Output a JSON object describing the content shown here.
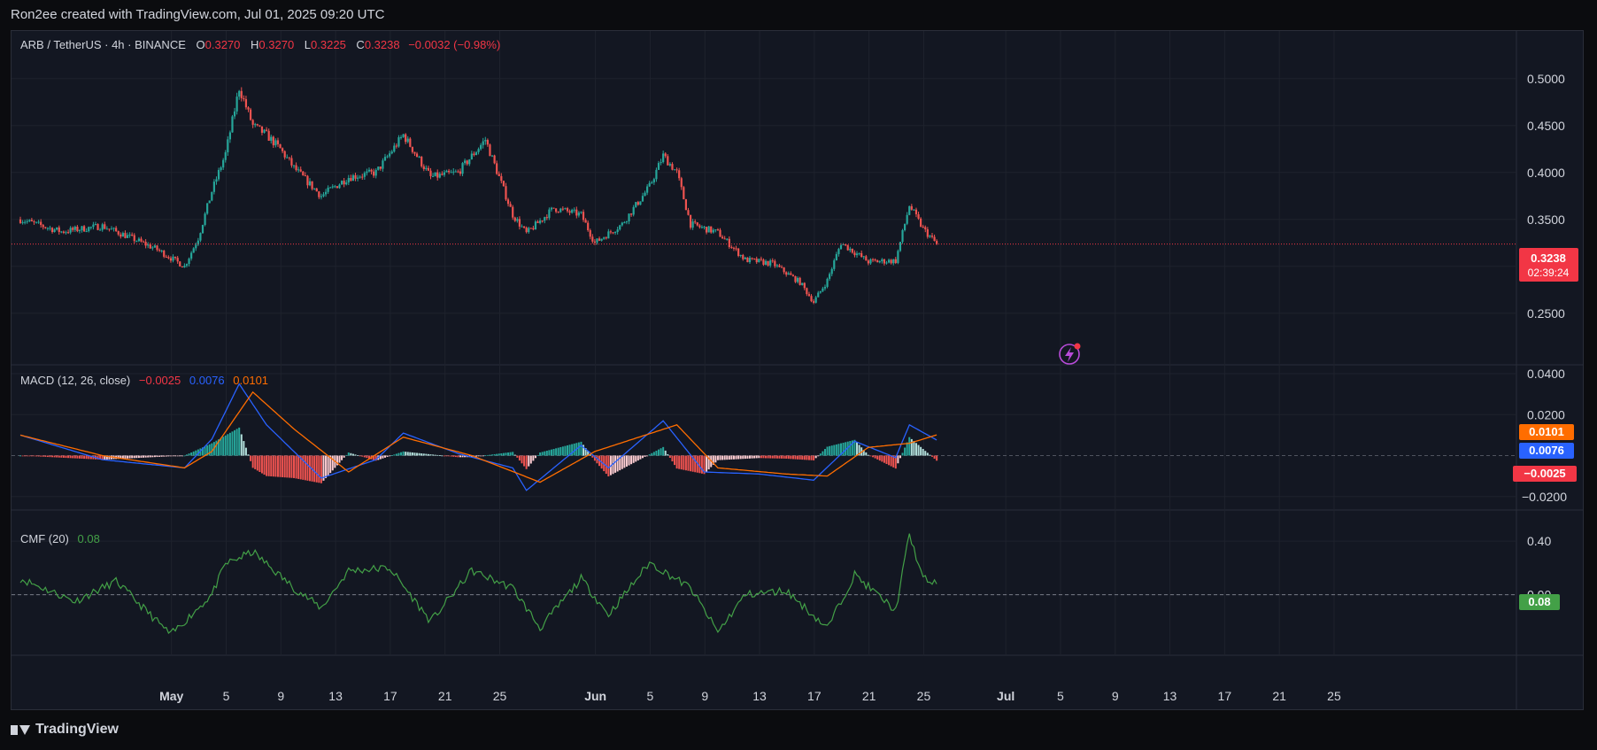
{
  "header": {
    "credit": "Ron2ee created with TradingView.com, Jul 01, 2025 09:20 UTC"
  },
  "legend": {
    "symbol": "ARB / TetherUS · 4h · BINANCE",
    "o_label": "O",
    "o_value": "0.3270",
    "h_label": "H",
    "h_value": "0.3270",
    "l_label": "L",
    "l_value": "0.3225",
    "c_label": "C",
    "c_value": "0.3238",
    "change": "−0.0032 (−0.98%)"
  },
  "price_badge": {
    "price": "0.3238",
    "countdown": "02:39:24"
  },
  "macd_legend": {
    "name": "MACD (12, 26, close)",
    "hist": "−0.0025",
    "macd": "0.0076",
    "signal": "0.0101"
  },
  "macd_badges": {
    "signal": "0.0101",
    "macd": "0.0076",
    "hist": "−0.0025"
  },
  "cmf_legend": {
    "name": "CMF (20)",
    "value": "0.08"
  },
  "cmf_badge": "0.08",
  "colors": {
    "up": "#26a69a",
    "down": "#ef5350",
    "macd": "#2962ff",
    "signal": "#ff6d00",
    "cmf": "#43a047",
    "badge_red": "#f23645"
  },
  "icons": {
    "alert": "lightning-alert-icon"
  },
  "footer": {
    "brand": "TradingView"
  },
  "chart_data": [
    {
      "type": "candlestick",
      "title": "ARB / TetherUS · 4h · BINANCE",
      "x_ticks": [
        "May",
        "5",
        "9",
        "13",
        "17",
        "21",
        "25",
        "Jun",
        "5",
        "9",
        "13",
        "17",
        "21",
        "25",
        "Jul",
        "5",
        "9",
        "13",
        "17",
        "21",
        "25"
      ],
      "y_ticks": [
        "0.5000",
        "0.4500",
        "0.4000",
        "0.3500",
        "0.3000",
        "0.2500"
      ],
      "ylim": [
        0.23,
        0.53
      ],
      "last_price": 0.3238,
      "close_series": [
        {
          "date": "Apr 25",
          "close": 0.35
        },
        {
          "date": "Apr 28",
          "close": 0.337
        },
        {
          "date": "May 1",
          "close": 0.343
        },
        {
          "date": "May 3",
          "close": 0.331
        },
        {
          "date": "May 5",
          "close": 0.318
        },
        {
          "date": "May 7",
          "close": 0.3
        },
        {
          "date": "May 8",
          "close": 0.33
        },
        {
          "date": "May 9",
          "close": 0.38
        },
        {
          "date": "May 10",
          "close": 0.42
        },
        {
          "date": "May 11",
          "close": 0.49
        },
        {
          "date": "May 12",
          "close": 0.45
        },
        {
          "date": "May 13",
          "close": 0.44
        },
        {
          "date": "May 14",
          "close": 0.425
        },
        {
          "date": "May 15",
          "close": 0.405
        },
        {
          "date": "May 17",
          "close": 0.375
        },
        {
          "date": "May 19",
          "close": 0.395
        },
        {
          "date": "May 21",
          "close": 0.4
        },
        {
          "date": "May 23",
          "close": 0.44
        },
        {
          "date": "May 25",
          "close": 0.395
        },
        {
          "date": "May 27",
          "close": 0.4
        },
        {
          "date": "May 29",
          "close": 0.435
        },
        {
          "date": "May 31",
          "close": 0.355
        },
        {
          "date": "Jun 1",
          "close": 0.335
        },
        {
          "date": "Jun 3",
          "close": 0.362
        },
        {
          "date": "Jun 5",
          "close": 0.355
        },
        {
          "date": "Jun 6",
          "close": 0.325
        },
        {
          "date": "Jun 8",
          "close": 0.345
        },
        {
          "date": "Jun 10",
          "close": 0.385
        },
        {
          "date": "Jun 11",
          "close": 0.418
        },
        {
          "date": "Jun 12",
          "close": 0.4
        },
        {
          "date": "Jun 13",
          "close": 0.345
        },
        {
          "date": "Jun 15",
          "close": 0.336
        },
        {
          "date": "Jun 17",
          "close": 0.307
        },
        {
          "date": "Jun 19",
          "close": 0.303
        },
        {
          "date": "Jun 21",
          "close": 0.283
        },
        {
          "date": "Jun 22",
          "close": 0.262
        },
        {
          "date": "Jun 23",
          "close": 0.285
        },
        {
          "date": "Jun 24",
          "close": 0.325
        },
        {
          "date": "Jun 26",
          "close": 0.305
        },
        {
          "date": "Jun 28",
          "close": 0.306
        },
        {
          "date": "Jun 29",
          "close": 0.365
        },
        {
          "date": "Jun 30",
          "close": 0.34
        },
        {
          "date": "Jul 1",
          "close": 0.3238
        }
      ]
    },
    {
      "type": "line",
      "title": "MACD (12, 26, close)",
      "y_ticks": [
        "0.0400",
        "0.0200",
        "−0.0200"
      ],
      "ylim": [
        -0.024,
        0.04
      ],
      "last": {
        "macd": 0.0076,
        "signal": 0.0101,
        "histogram": -0.0025
      },
      "series": [
        {
          "name": "MACD",
          "values": [
            {
              "date": "Apr 25",
              "v": 0.01
            },
            {
              "date": "May 1",
              "v": -0.002
            },
            {
              "date": "May 7",
              "v": -0.006
            },
            {
              "date": "May 9",
              "v": 0.008
            },
            {
              "date": "May 11",
              "v": 0.035
            },
            {
              "date": "May 13",
              "v": 0.015
            },
            {
              "date": "May 17",
              "v": -0.011
            },
            {
              "date": "May 21",
              "v": -0.002
            },
            {
              "date": "May 23",
              "v": 0.011
            },
            {
              "date": "May 27",
              "v": 0.001
            },
            {
              "date": "May 31",
              "v": -0.006
            },
            {
              "date": "Jun 1",
              "v": -0.017
            },
            {
              "date": "Jun 5",
              "v": 0.005
            },
            {
              "date": "Jun 7",
              "v": -0.006
            },
            {
              "date": "Jun 11",
              "v": 0.017
            },
            {
              "date": "Jun 14",
              "v": -0.008
            },
            {
              "date": "Jun 18",
              "v": -0.009
            },
            {
              "date": "Jun 22",
              "v": -0.012
            },
            {
              "date": "Jun 25",
              "v": 0.007
            },
            {
              "date": "Jun 28",
              "v": -0.001
            },
            {
              "date": "Jun 29",
              "v": 0.015
            },
            {
              "date": "Jul 1",
              "v": 0.0076
            }
          ]
        },
        {
          "name": "Signal",
          "values": [
            {
              "date": "Apr 25",
              "v": 0.01
            },
            {
              "date": "May 1",
              "v": 0.0
            },
            {
              "date": "May 7",
              "v": -0.006
            },
            {
              "date": "May 9",
              "v": 0.002
            },
            {
              "date": "May 12",
              "v": 0.031
            },
            {
              "date": "May 15",
              "v": 0.013
            },
            {
              "date": "May 19",
              "v": -0.008
            },
            {
              "date": "May 23",
              "v": 0.009
            },
            {
              "date": "May 28",
              "v": 0.0
            },
            {
              "date": "Jun 2",
              "v": -0.013
            },
            {
              "date": "Jun 6",
              "v": 0.002
            },
            {
              "date": "Jun 12",
              "v": 0.015
            },
            {
              "date": "Jun 15",
              "v": -0.006
            },
            {
              "date": "Jun 20",
              "v": -0.009
            },
            {
              "date": "Jun 23",
              "v": -0.01
            },
            {
              "date": "Jun 26",
              "v": 0.004
            },
            {
              "date": "Jun 29",
              "v": 0.006
            },
            {
              "date": "Jul 1",
              "v": 0.0101
            }
          ]
        }
      ]
    },
    {
      "type": "line",
      "title": "CMF (20)",
      "y_ticks": [
        "0.40",
        "0.00"
      ],
      "ylim": [
        -0.42,
        0.56
      ],
      "last": 0.08,
      "series": [
        {
          "name": "CMF",
          "values": [
            {
              "date": "Apr 25",
              "v": 0.12
            },
            {
              "date": "Apr 29",
              "v": -0.05
            },
            {
              "date": "May 2",
              "v": 0.1
            },
            {
              "date": "May 6",
              "v": -0.3
            },
            {
              "date": "May 9",
              "v": 0.0
            },
            {
              "date": "May 10",
              "v": 0.23
            },
            {
              "date": "May 12",
              "v": 0.32
            },
            {
              "date": "May 15",
              "v": 0.05
            },
            {
              "date": "May 17",
              "v": -0.1
            },
            {
              "date": "May 19",
              "v": 0.18
            },
            {
              "date": "May 22",
              "v": 0.2
            },
            {
              "date": "May 25",
              "v": -0.2
            },
            {
              "date": "May 28",
              "v": 0.18
            },
            {
              "date": "May 31",
              "v": 0.05
            },
            {
              "date": "Jun 2",
              "v": -0.25
            },
            {
              "date": "Jun 5",
              "v": 0.12
            },
            {
              "date": "Jun 7",
              "v": -0.15
            },
            {
              "date": "Jun 10",
              "v": 0.24
            },
            {
              "date": "Jun 13",
              "v": 0.05
            },
            {
              "date": "Jun 15",
              "v": -0.28
            },
            {
              "date": "Jun 17",
              "v": 0.0
            },
            {
              "date": "Jun 20",
              "v": 0.03
            },
            {
              "date": "Jun 23",
              "v": -0.25
            },
            {
              "date": "Jun 25",
              "v": 0.15
            },
            {
              "date": "Jun 28",
              "v": -0.12
            },
            {
              "date": "Jun 29",
              "v": 0.45
            },
            {
              "date": "Jun 30",
              "v": 0.12
            },
            {
              "date": "Jul 1",
              "v": 0.08
            }
          ]
        }
      ]
    }
  ]
}
